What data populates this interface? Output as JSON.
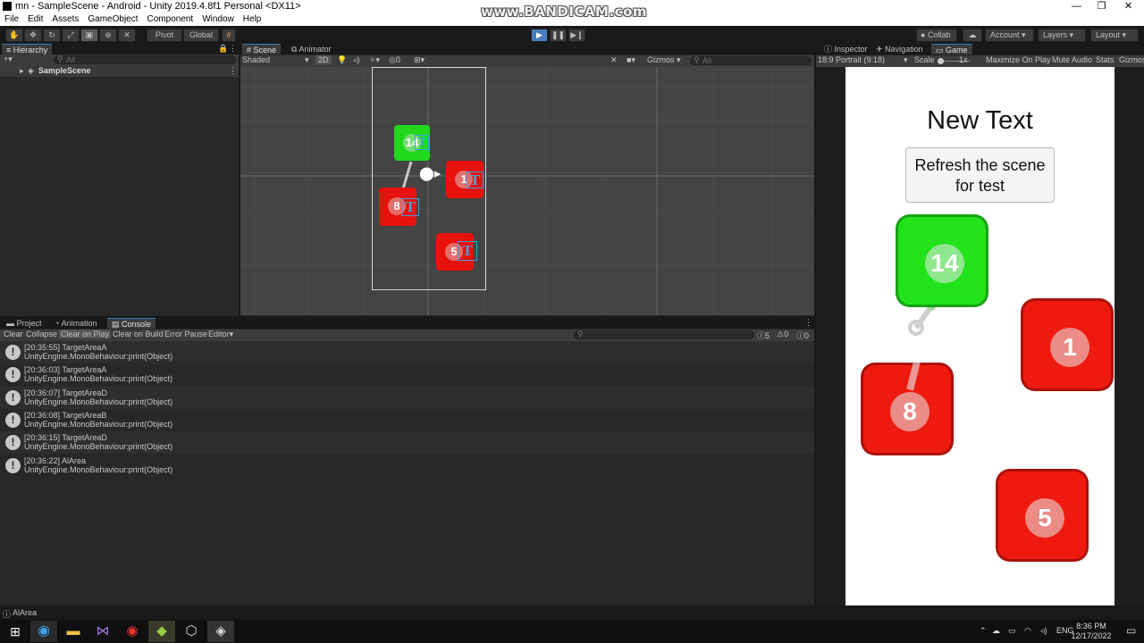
{
  "window": {
    "title": "mn - SampleScene - Android - Unity 2019.4.8f1 Personal <DX11>",
    "watermark": "www.BANDICAM.com",
    "controls": [
      "—",
      "❐",
      "✕"
    ]
  },
  "menu": [
    "File",
    "Edit",
    "Assets",
    "GameObject",
    "Component",
    "Window",
    "Help"
  ],
  "toolbar": {
    "pivot": "Pivot",
    "global": "Global",
    "collab": "Collab",
    "account": "Account",
    "layers": "Layers",
    "layout": "Layout"
  },
  "hierarchy": {
    "tab": "Hierarchy",
    "search_placeholder": "All",
    "scene_name": "SampleScene"
  },
  "scene": {
    "tabs": [
      "Scene",
      "Animator"
    ],
    "shading": "Shaded",
    "mode_2d": "2D",
    "layers_count": "0",
    "gizmos": "Gizmos",
    "search_placeholder": "All",
    "tiles": [
      {
        "number": "14",
        "color": "#22d81c"
      },
      {
        "number": "1",
        "color": "#e8120d"
      },
      {
        "number": "8",
        "color": "#e8120d"
      },
      {
        "number": "5",
        "color": "#e8120d"
      }
    ]
  },
  "bottom": {
    "tabs": [
      "Project",
      "Animation",
      "Console"
    ],
    "console_buttons": [
      "Clear",
      "Collapse",
      "Clear on Play",
      "Clear on Build",
      "Error Pause",
      "Editor"
    ],
    "counts": {
      "logs": "5",
      "warnings": "0",
      "errors": "0"
    },
    "logs": [
      {
        "time_msg": "[20:35:55] TargetAreaA",
        "detail": "UnityEngine.MonoBehaviour:print(Object)"
      },
      {
        "time_msg": "[20:36:03] TargetAreaA",
        "detail": "UnityEngine.MonoBehaviour:print(Object)"
      },
      {
        "time_msg": "[20:36:07] TargetAreaD",
        "detail": "UnityEngine.MonoBehaviour:print(Object)"
      },
      {
        "time_msg": "[20:36:08] TargetAreaB",
        "detail": "UnityEngine.MonoBehaviour:print(Object)"
      },
      {
        "time_msg": "[20:36:15] TargetAreaD",
        "detail": "UnityEngine.MonoBehaviour:print(Object)"
      },
      {
        "time_msg": "[20:36:22] AlArea",
        "detail": "UnityEngine.MonoBehaviour:print(Object)"
      }
    ]
  },
  "right": {
    "tabs": [
      "Inspector",
      "Navigation",
      "Game"
    ],
    "resolution": "18:9 Portrait (9:18)",
    "scale_label": "Scale",
    "scale_value": "1x",
    "maximize": "Maximize On Play",
    "mute": "Mute Audio",
    "stats": "Stats",
    "gizmos": "Gizmos"
  },
  "game": {
    "heading": "New Text",
    "button_line1": "Refresh the scene",
    "button_line2": "for test",
    "tiles": [
      {
        "number": "14",
        "color": "#22e21c"
      },
      {
        "number": "1",
        "color": "#ee1a0f"
      },
      {
        "number": "8",
        "color": "#ee1a0f"
      },
      {
        "number": "5",
        "color": "#ee1a0f"
      }
    ]
  },
  "status": {
    "message": "AlArea"
  },
  "taskbar": {
    "lang": "ENG",
    "time": "8:36 PM",
    "date": "12/17/2022"
  }
}
